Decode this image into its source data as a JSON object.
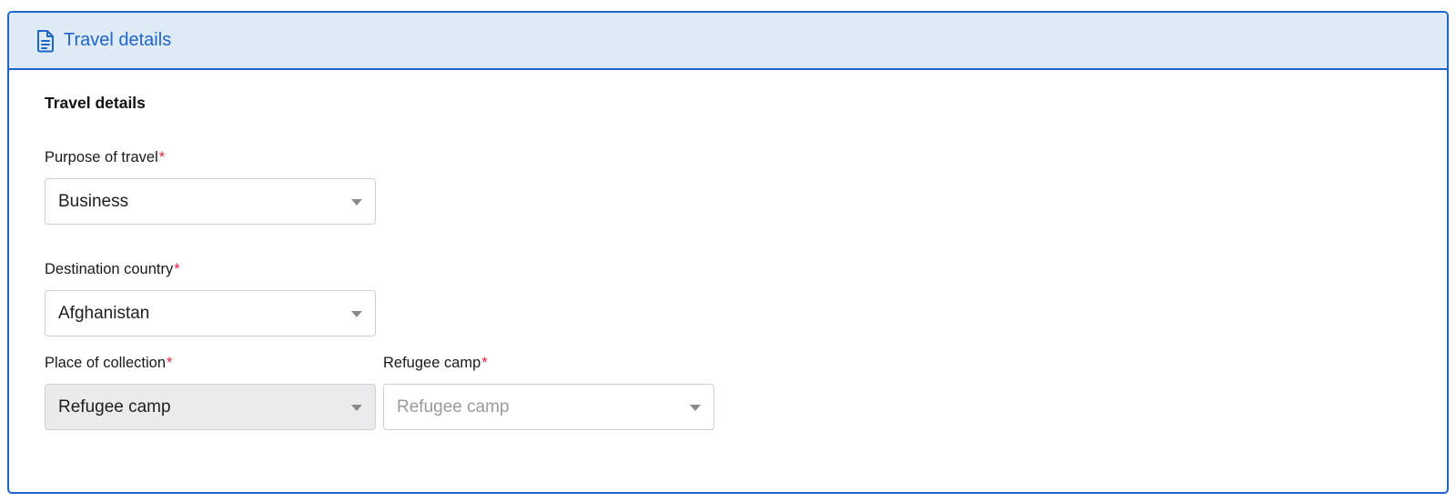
{
  "panel": {
    "header_title": "Travel details",
    "header_icon": "document-icon",
    "accent_color": "#1f64c8",
    "header_bg": "#deebf7"
  },
  "section": {
    "title": "Travel details"
  },
  "fields": {
    "purpose": {
      "label": "Purpose of travel",
      "required_mark": "*",
      "value": "Business"
    },
    "destination": {
      "label": "Destination country",
      "required_mark": "*",
      "value": "Afghanistan"
    },
    "place_of_collection": {
      "label": "Place of collection",
      "required_mark": "*",
      "value": "Refugee camp",
      "disabled": true
    },
    "refugee_camp": {
      "label": "Refugee camp",
      "required_mark": "*",
      "placeholder": "Refugee camp"
    }
  }
}
